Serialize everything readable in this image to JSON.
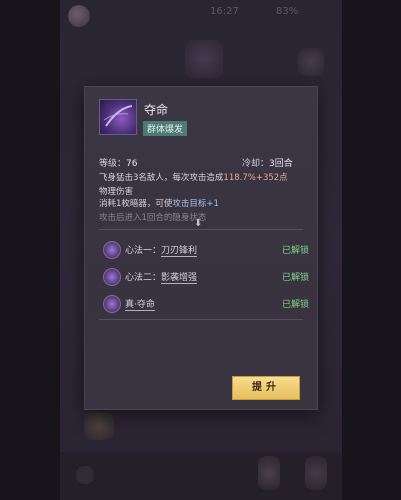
{
  "status": {
    "left": "16:27",
    "right": "83%"
  },
  "skill": {
    "name": "夺命",
    "tag": "群体爆发",
    "level_label": "等级：",
    "level_value": "76",
    "cd_label": "冷却：",
    "cd_value": "3回合",
    "desc_line1_a": "飞身猛击3名敌人，每次攻击造成",
    "desc_line1_b": "118.7%+352点",
    "desc_line1_c": "物理伤害",
    "desc_line2_a": "消耗1枚暗器，可使",
    "desc_line2_b": "攻击目标+1",
    "desc_line3": "攻击后进入1回合的隐身状态"
  },
  "methods": [
    {
      "prefix": "心法一：",
      "name": "刀刃锋利",
      "status": "已解锁"
    },
    {
      "prefix": "心法二：",
      "name": "影袭增强",
      "status": "已解锁"
    },
    {
      "prefix": "",
      "name": "真·夺命",
      "status": "已解锁"
    }
  ],
  "upgrade_label": "提升",
  "colors": {
    "accent_gold": "#e7bf5c",
    "unlocked_green": "#7fd48c",
    "tag_teal": "#4d7a76"
  },
  "icons": {
    "fold": "chevron-double-down-icon"
  }
}
